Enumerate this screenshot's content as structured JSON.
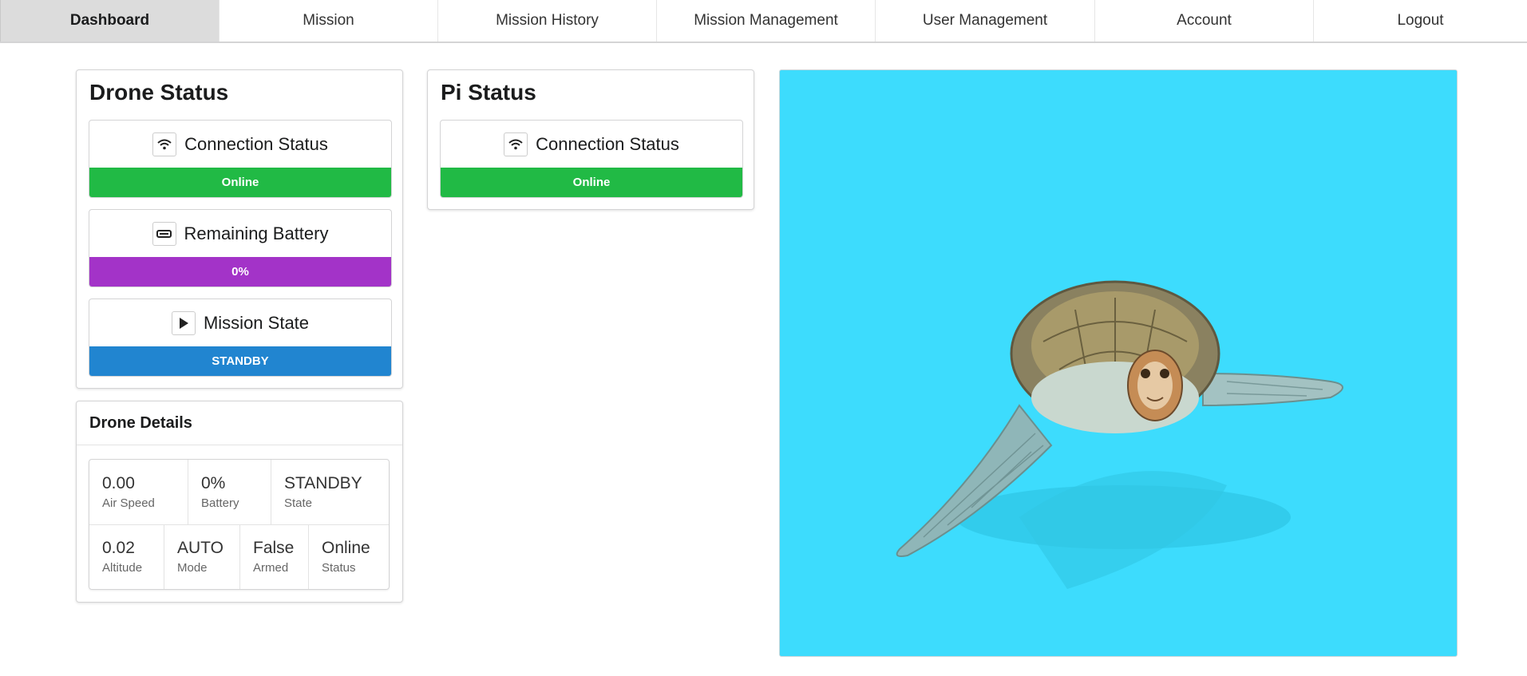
{
  "nav": {
    "items": [
      {
        "label": "Dashboard"
      },
      {
        "label": "Mission"
      },
      {
        "label": "Mission History"
      },
      {
        "label": "Mission Management"
      },
      {
        "label": "User Management"
      },
      {
        "label": "Account"
      },
      {
        "label": "Logout"
      }
    ],
    "active": "Dashboard"
  },
  "drone_status": {
    "title": "Drone Status",
    "connection": {
      "label": "Connection Status",
      "value": "Online",
      "color": "#21ba45",
      "icon": "wifi-icon"
    },
    "battery": {
      "label": "Remaining Battery",
      "value": "0%",
      "color": "#a333c8",
      "icon": "battery-icon"
    },
    "mission_state": {
      "label": "Mission State",
      "value": "STANDBY",
      "color": "#2185d0",
      "icon": "play-icon"
    }
  },
  "pi_status": {
    "title": "Pi Status",
    "connection": {
      "label": "Connection Status",
      "value": "Online",
      "color": "#21ba45",
      "icon": "wifi-icon"
    }
  },
  "drone_details": {
    "title": "Drone Details",
    "row1": [
      {
        "value": "0.00",
        "label": "Air Speed"
      },
      {
        "value": "0%",
        "label": "Battery"
      },
      {
        "value": "STANDBY",
        "label": "State"
      }
    ],
    "row2": [
      {
        "value": "0.02",
        "label": "Altitude"
      },
      {
        "value": "AUTO",
        "label": "Mode"
      },
      {
        "value": "False",
        "label": "Armed"
      },
      {
        "value": "Online",
        "label": "Status"
      }
    ]
  },
  "image_panel": {
    "background": "#3ddcfd",
    "subject": "sea-turtle"
  }
}
